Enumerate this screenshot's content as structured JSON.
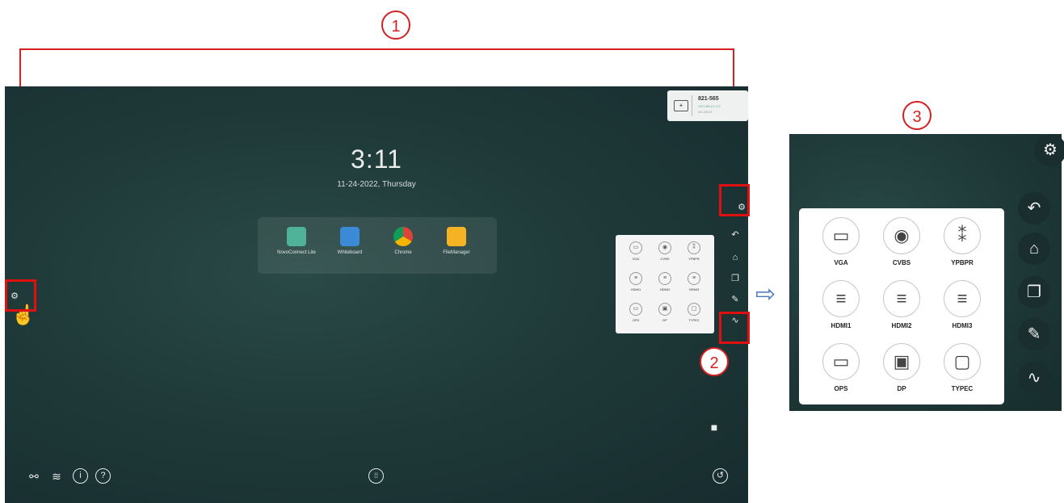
{
  "screen": {
    "time": "3:11",
    "date": "11-24-2022, Thursday",
    "apps": [
      {
        "label": "NovoConnect Lite",
        "color": "#4fb39a"
      },
      {
        "label": "Whiteboard",
        "color": "#3b8ad8"
      },
      {
        "label": "Chrome",
        "color": "#ffffff"
      },
      {
        "label": "FileManager",
        "color": "#f5b324"
      }
    ],
    "id_card": {
      "code": "821-565",
      "line1": "192.168.10.172",
      "line2": "NV-00221"
    }
  },
  "sources": [
    "VGA",
    "CVBS",
    "YPBPR",
    "HDMI1",
    "HDMI2",
    "HDMI3",
    "OPS",
    "DP",
    "TYPEC"
  ],
  "callouts": [
    "1",
    "2",
    "3"
  ],
  "colors": {
    "highlight": "#e01010",
    "arrow": "#4a77c0"
  }
}
